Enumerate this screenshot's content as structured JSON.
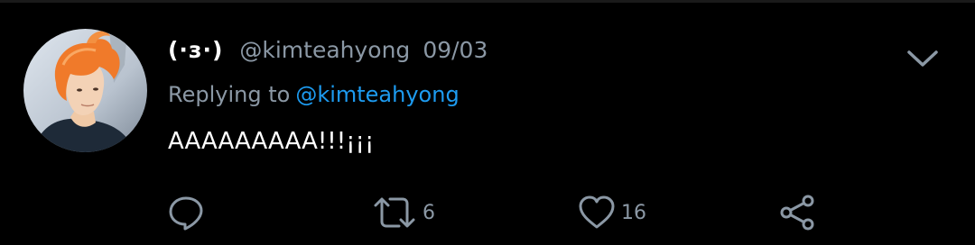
{
  "tweet": {
    "display_name": "(·з·)",
    "handle": "@kimteahyong",
    "date": "09/03",
    "reply_prefix": "Replying to",
    "reply_handle": "@kimteahyong",
    "text": "AAAAAAAAA!!!¡¡¡",
    "avatar": "avatar-orange-hair-photo"
  },
  "actions": {
    "reply": {
      "icon": "reply-icon",
      "count": ""
    },
    "retweet": {
      "icon": "retweet-icon",
      "count": "6"
    },
    "like": {
      "icon": "heart-icon",
      "count": "16"
    },
    "share": {
      "icon": "share-icon"
    }
  },
  "colors": {
    "background": "#000000",
    "text": "#ffffff",
    "muted": "#8b98a5",
    "link": "#1d9bf0"
  }
}
